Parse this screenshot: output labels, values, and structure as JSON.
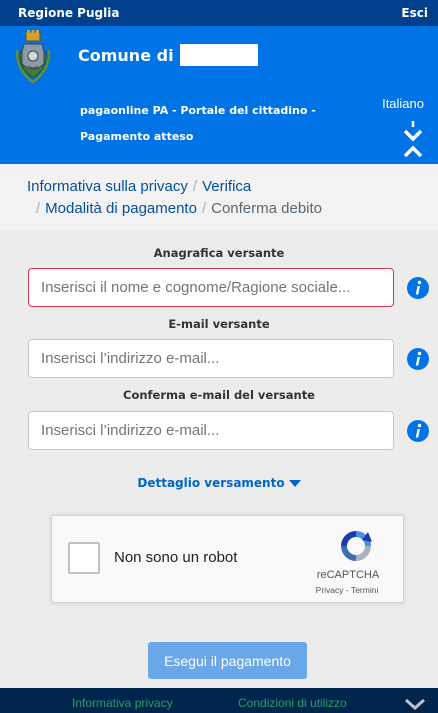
{
  "topbar": {
    "region": "Regione Puglia",
    "exit": "Esci"
  },
  "header": {
    "comune_prefix": "Comune di",
    "portal_title": "pagaonline PA - Portale del cittadino -",
    "page_subtitle": "Pagamento atteso",
    "language": "Italiano"
  },
  "breadcrumb": {
    "items": [
      "Informativa sulla privacy",
      "Verifica",
      "Modalità di pagamento",
      "Conferma debito"
    ],
    "separator": "/"
  },
  "form": {
    "anagrafica": {
      "label": "Anagrafica versante",
      "placeholder": "Inserisci il nome e cognome/Ragione sociale...",
      "value": ""
    },
    "email": {
      "label": "E-mail versante",
      "placeholder": "Inserisci l’indirizzo e-mail...",
      "value": ""
    },
    "email_confirm": {
      "label": "Conferma e-mail del versante",
      "placeholder": "Inserisci l’indirizzo e-mail...",
      "value": ""
    },
    "dettaglio": "Dettaglio versamento"
  },
  "recaptcha": {
    "label": "Non sono un robot",
    "brand": "reCAPTCHA",
    "privacy": "Privacy",
    "terms": "Termini",
    "links_sep": " - "
  },
  "actions": {
    "submit": "Esegui il pagamento"
  },
  "footer": {
    "privacy": "Informativa privacy",
    "conditions": "Condizioni di utilizzo"
  },
  "colors": {
    "topbar": "#00408c",
    "header": "#0073e6",
    "link": "#00509e",
    "error_border": "#d9364f",
    "info_icon": "#0073e6",
    "submit": "#6aa7e8",
    "footer": "#00264d"
  },
  "icons": [
    "coat-of-arms-icon",
    "collapse-icon",
    "info-icon",
    "caret-down-icon",
    "recaptcha-logo-icon"
  ]
}
